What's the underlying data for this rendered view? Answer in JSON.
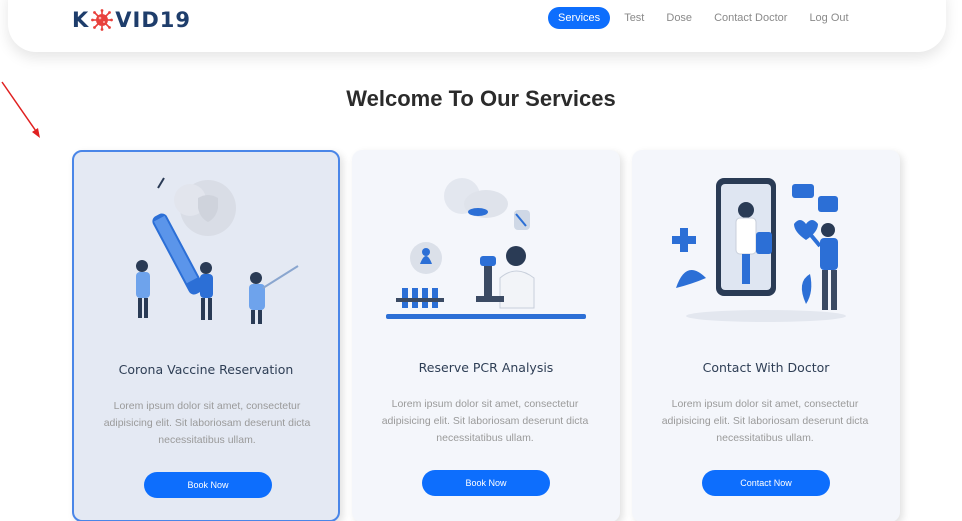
{
  "brand": {
    "logo_left": "K",
    "logo_right": "VID19",
    "virus_color": "#e8413c"
  },
  "nav": {
    "items": [
      "Services",
      "Test",
      "Dose",
      "Contact Doctor",
      "Log Out"
    ],
    "active": "Services"
  },
  "page": {
    "title": "Welcome To Our Services"
  },
  "cards": [
    {
      "title": "Corona Vaccine Reservation",
      "description": "Lorem ipsum dolor sit amet, consectetur adipisicing elit. Sit laboriosam deserunt dicta necessitatibus ullam.",
      "button": "Book Now",
      "illustration": "vaccine-team-illustration"
    },
    {
      "title": "Reserve PCR Analysis",
      "description": "Lorem ipsum dolor sit amet, consectetur adipisicing elit. Sit laboriosam deserunt dicta necessitatibus ullam.",
      "button": "Book Now",
      "illustration": "lab-microscope-illustration"
    },
    {
      "title": "Contact With Doctor",
      "description": "Lorem ipsum dolor sit amet, consectetur adipisicing elit. Sit laboriosam deserunt dicta necessitatibus ullam.",
      "button": "Contact Now",
      "illustration": "doctor-video-call-illustration"
    }
  ],
  "colors": {
    "accent": "#0d6efd",
    "brand_text": "#1e3d6b",
    "annotation_arrow": "#e02020"
  }
}
